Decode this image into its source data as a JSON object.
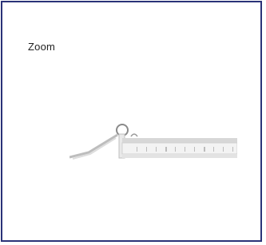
{
  "panel": {
    "label": "Zoom",
    "image_icon": "profile-clip-product-photo-icon",
    "border_color": "#2a3278"
  }
}
